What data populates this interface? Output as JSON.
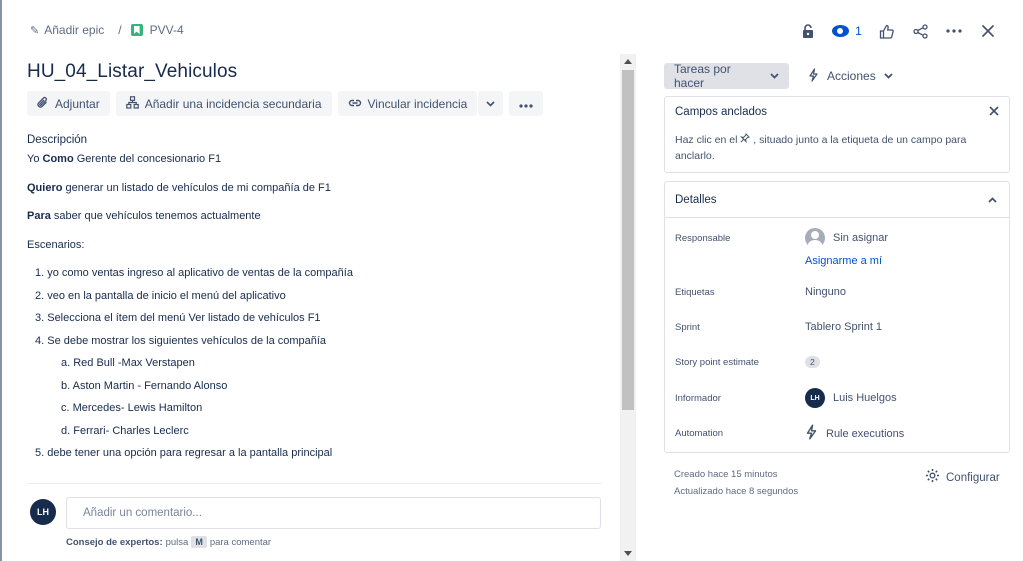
{
  "breadcrumb": {
    "add_epic": "Añadir epic",
    "separator": "/",
    "issue_key": "PVV-4"
  },
  "top_actions": {
    "watch_count": "1"
  },
  "issue": {
    "title": "HU_04_Listar_Vehiculos",
    "toolbar": {
      "attach": "Adjuntar",
      "add_subtask": "Añadir una incidencia secundaria",
      "link_issue": "Vincular incidencia"
    },
    "description_label": "Descripción",
    "story": {
      "as_kw": "Yo",
      "as_role_kw": "Como",
      "as_rest": "Gerente del concesionario F1",
      "want_kw": "Quiero",
      "want_rest": "generar un listado de vehículos de mi compañía de F1",
      "so_kw": "Para",
      "so_rest": "saber que vehículos tenemos actualmente"
    },
    "scenarios_label": "Escenarios:",
    "steps": [
      "1. yo como ventas ingreso al aplicativo de ventas de la compañía",
      "2. veo en la pantalla de inicio el menú del aplicativo",
      "3. Selecciona el ítem del menú Ver listado de vehículos F1",
      "4. Se debe mostrar los siguientes vehículos de la compañía"
    ],
    "sub_steps": [
      "a. Red Bull -Max Verstapen",
      "b. Aston Martin - Fernando Alonso",
      "c. Mercedes- Lewis Hamilton",
      "d. Ferrari- Charles Leclerc"
    ],
    "last_step": "5. debe tener una opción para regresar a la pantalla principal"
  },
  "comment": {
    "avatar": "LH",
    "placeholder": "Añadir un comentario...",
    "tip_bold": "Consejo de expertos:",
    "tip_pre": "pulsa",
    "tip_key": "M",
    "tip_post": "para comentar"
  },
  "sidebar": {
    "status": "Tareas por hacer",
    "actions": "Acciones",
    "pinned": {
      "title": "Campos anclados",
      "body_pre": "Haz clic en el",
      "body_post": ", situado junto a la etiqueta de un campo para anclarlo."
    },
    "details": {
      "title": "Detalles",
      "fields": {
        "assignee_label": "Responsable",
        "assignee_value": "Sin asignar",
        "assign_me": "Asignarme a mí",
        "labels_label": "Etiquetas",
        "labels_value": "Ninguno",
        "sprint_label": "Sprint",
        "sprint_value": "Tablero Sprint 1",
        "points_label": "Story point estimate",
        "points_value": "2",
        "reporter_label": "Informador",
        "reporter_avatar": "LH",
        "reporter_value": "Luis Huelgos",
        "automation_label": "Automation",
        "automation_value": "Rule executions"
      }
    },
    "created": "Creado hace 15 minutos",
    "updated": "Actualizado hace 8 segundos",
    "configure": "Configurar"
  }
}
